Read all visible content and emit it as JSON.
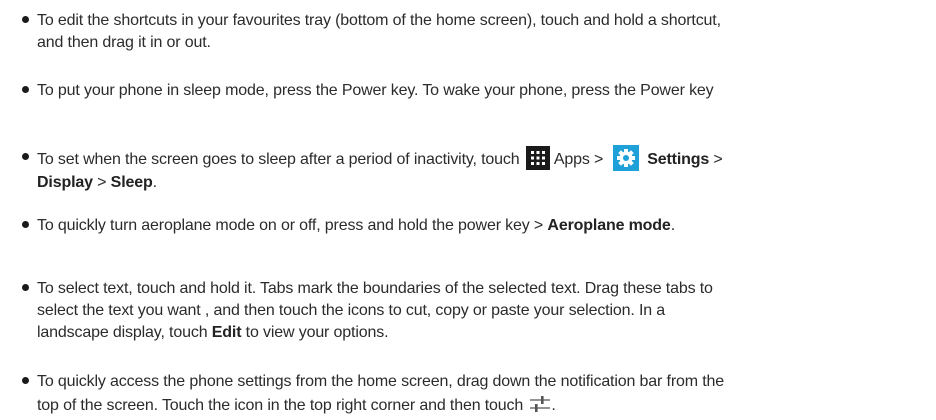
{
  "tips": [
    {
      "line1": "To edit the shortcuts in your favourites tray (bottom of the home screen), touch and hold a shortcut,",
      "line2": "and then drag it in or out."
    },
    {
      "line1": "To put your phone in sleep mode, press the Power key. To wake your phone, press the Power key"
    },
    {
      "line1_prefix": "To set when the screen goes to sleep after a period of inactivity, touch",
      "apps_label": "Apps",
      "sep1": ">",
      "settings_label": "Settings",
      "sep2": ">",
      "display_label": "Display",
      "sep3": ">",
      "sleep_label": "Sleep",
      "end": "."
    },
    {
      "prefix": "To quickly turn aeroplane mode on or off, press and hold the power key",
      "sep": ">",
      "aeroplane_label": "Aeroplane mode",
      "end": "."
    },
    {
      "line1": "To select text, touch and hold it. Tabs mark the boundaries of the selected text. Drag these tabs to",
      "line2": "select the text you want , and then touch the icons to cut, copy or paste your selection. In a",
      "line3_prefix": "landscape display, touch",
      "edit_label": "Edit",
      "line3_suffix": "to view your options."
    },
    {
      "line1": "To quickly access the phone settings from the home screen, drag down the notification bar from the",
      "line2_prefix": "top of the screen. Touch the icon in the top right corner and then touch",
      "end": "."
    }
  ],
  "icons": {
    "apps": "apps-grid-icon",
    "settings": "settings-gear-icon",
    "quick_settings": "sliders-icon"
  },
  "colors": {
    "text": "#2b2b2b",
    "settings_icon_bg": "#1ea0d8",
    "apps_icon_bg": "#1a1a1a"
  }
}
